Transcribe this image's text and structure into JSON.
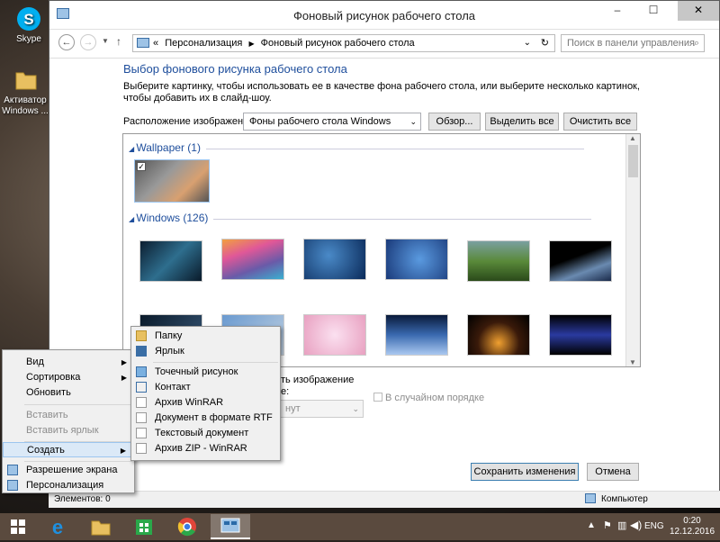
{
  "desktop": {
    "icons": [
      {
        "label": "Skype"
      },
      {
        "label": "Активатор Windows ..."
      }
    ]
  },
  "window": {
    "title": "Фоновый рисунок рабочего стола",
    "controls": {
      "minimize": "–",
      "maximize": "☐",
      "close": "✕"
    },
    "address": {
      "prefix": "«",
      "path": [
        "Персонализация",
        "Фоновый рисунок рабочего стола"
      ]
    },
    "search": {
      "placeholder": "Поиск в панели управления"
    },
    "heading": "Выбор фонового рисунка рабочего стола",
    "description": "Выберите картинку, чтобы использовать ее в качестве фона рабочего стола, или выберите несколько картинок, чтобы добавить их в слайд-шоу.",
    "location_label": "Расположение изображения:",
    "location_value": "Фоны рабочего стола Windows",
    "buttons": {
      "browse": "Обзор...",
      "select_all": "Выделить все",
      "clear_all": "Очистить все"
    },
    "groups": [
      {
        "title": "Wallpaper (1)"
      },
      {
        "title": "Windows (126)"
      }
    ],
    "bottom": {
      "position_label": "ть изображение",
      "position_sub": "е:",
      "interval_value": "нут",
      "shuffle_label": "В случайном порядке",
      "save": "Сохранить изменения",
      "cancel": "Отмена"
    },
    "status": {
      "items_count": "Элементов: 0",
      "computer": "Компьютер"
    }
  },
  "context_menu": {
    "items": [
      {
        "label": "Вид",
        "submenu": true,
        "disabled": false
      },
      {
        "label": "Сортировка",
        "submenu": true,
        "disabled": false
      },
      {
        "label": "Обновить",
        "submenu": false,
        "disabled": false
      },
      {
        "label": "Вставить",
        "submenu": false,
        "disabled": true
      },
      {
        "label": "Вставить ярлык",
        "submenu": false,
        "disabled": true
      },
      {
        "label": "Создать",
        "submenu": true,
        "disabled": false,
        "selected": true
      },
      {
        "label": "Разрешение экрана",
        "submenu": false,
        "disabled": false
      },
      {
        "label": "Персонализация",
        "submenu": false,
        "disabled": false
      }
    ]
  },
  "submenu": {
    "items": [
      {
        "label": "Папку",
        "icon": "folder-icon"
      },
      {
        "label": "Ярлык",
        "icon": "shortcut-icon"
      },
      {
        "label": "Точечный рисунок",
        "icon": "bitmap-icon"
      },
      {
        "label": "Контакт",
        "icon": "contact-icon"
      },
      {
        "label": "Архив WinRAR",
        "icon": "rar-icon"
      },
      {
        "label": "Документ в формате RTF",
        "icon": "rtf-icon"
      },
      {
        "label": "Текстовый документ",
        "icon": "text-doc-icon"
      },
      {
        "label": "Архив ZIP - WinRAR",
        "icon": "zip-icon"
      }
    ]
  },
  "taskbar": {
    "tray": {
      "lang": "ENG",
      "time": "0:20",
      "date": "12.12.2016"
    }
  },
  "colors": {
    "accent": "#1e4e9c",
    "taskbar": "#5a4a3e"
  }
}
